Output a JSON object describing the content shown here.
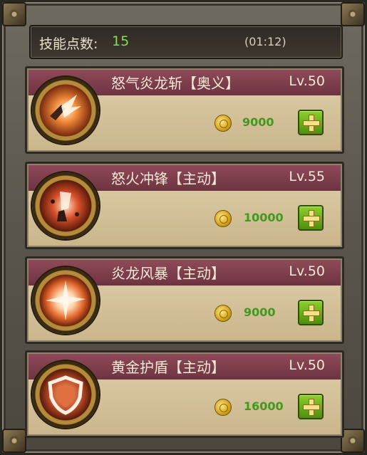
{
  "header": {
    "skill_points_label": "技能点数:",
    "skill_points_value": "15",
    "timer": "(01:12)"
  },
  "skills": [
    {
      "name": "怒气炎龙斩【奥义】",
      "level": "Lv.50",
      "cost": "9000",
      "icon": "dragon-slash-icon"
    },
    {
      "name": "怒火冲锋【主动】",
      "level": "Lv.55",
      "cost": "10000",
      "icon": "rage-charge-icon"
    },
    {
      "name": "炎龙风暴【主动】",
      "level": "Lv.50",
      "cost": "9000",
      "icon": "dragon-storm-icon"
    },
    {
      "name": "黄金护盾【主动】",
      "level": "Lv.50",
      "cost": "16000",
      "icon": "golden-shield-icon"
    }
  ],
  "colors": {
    "points_green": "#7fe04a",
    "cost_green": "#3f9a1e",
    "card_band": "#8f4a58"
  }
}
